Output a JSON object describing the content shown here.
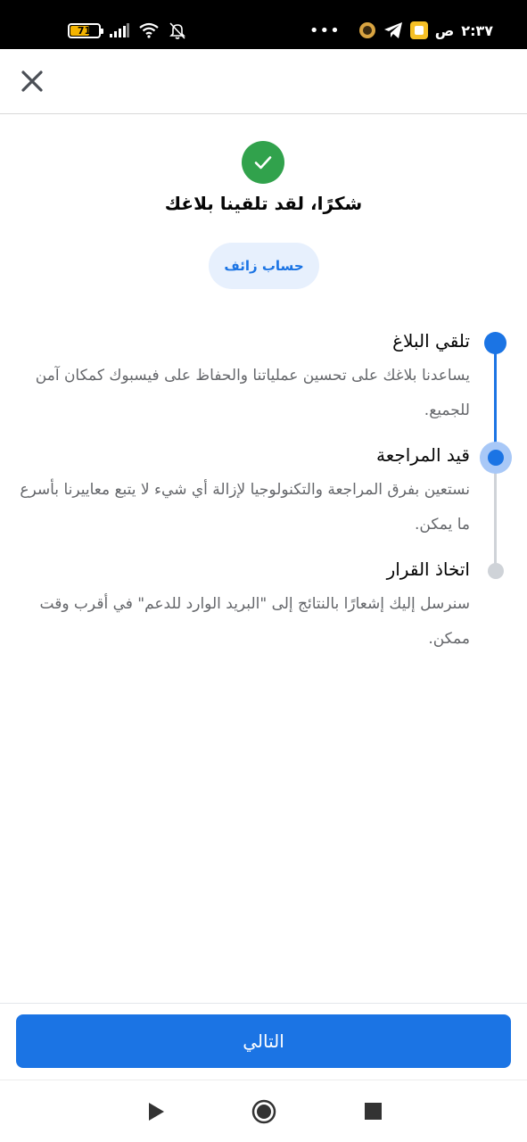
{
  "status_bar": {
    "battery_level": "71",
    "time": "٢:٣٧",
    "am_pm": "ص",
    "more_dots": "•••",
    "icons": [
      "battery-icon",
      "signal-icon",
      "wifi-icon",
      "bell-off-icon",
      "app-notification-icon",
      "telegram-icon",
      "notes-app-icon"
    ],
    "colors": {
      "background": "#000000",
      "battery_fill": "#f4b400"
    }
  },
  "header": {
    "close_icon": "close-icon"
  },
  "confirmation": {
    "title": "شكرًا، لقد تلقينا بلاغك",
    "report_type_chip": "حساب زائف",
    "icon": "check-icon",
    "colors": {
      "check_background": "#31a24c",
      "chip_background": "#e7f0fd",
      "chip_text": "#1b74e4"
    }
  },
  "timeline": {
    "steps": [
      {
        "title": "تلقي البلاغ",
        "description": "يساعدنا بلاغك على تحسين عملياتنا والحفاظ على فيسبوك كمكان آمن للجميع.",
        "status": "completed"
      },
      {
        "title": "قيد المراجعة",
        "description": "نستعين بفرق المراجعة والتكنولوجيا لإزالة أي شيء لا يتبع معاييرنا بأسرع ما يمكن.",
        "status": "current"
      },
      {
        "title": "اتخاذ القرار",
        "description": "سنرسل إليك إشعارًا بالنتائج إلى \"البريد الوارد للدعم\" في أقرب وقت ممكن.",
        "status": "pending"
      }
    ],
    "colors": {
      "active": "#1b74e4",
      "current_halo": "#a8c8f7",
      "inactive": "#cfd3d8"
    }
  },
  "footer": {
    "next_button_label": "التالي",
    "colors": {
      "button_background": "#1b74e4",
      "button_text": "#ffffff"
    }
  },
  "nav_bar": {
    "icons": [
      "back-icon",
      "home-icon",
      "recents-icon"
    ]
  }
}
